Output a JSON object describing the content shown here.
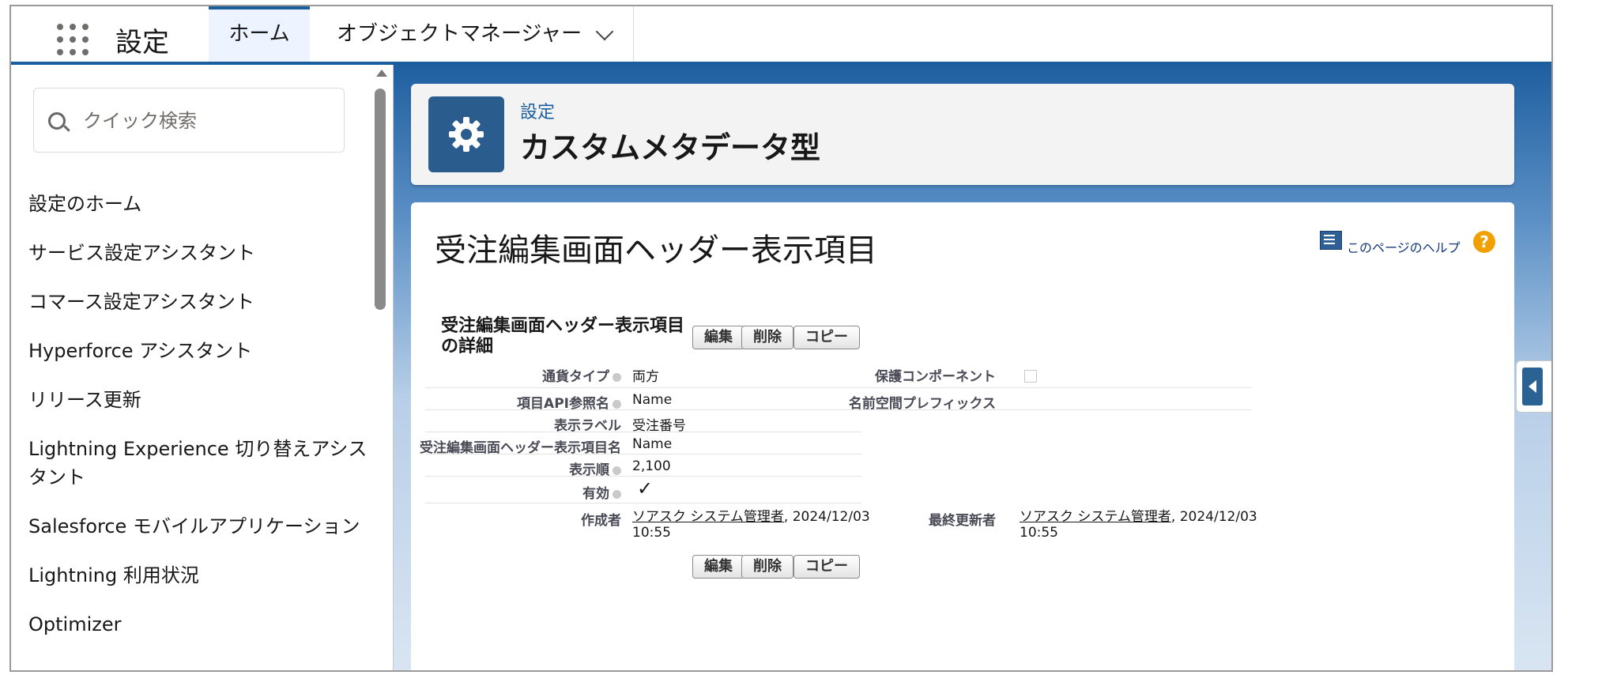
{
  "nav": {
    "app_name": "設定",
    "tabs": [
      {
        "label": "ホーム"
      },
      {
        "label": "オブジェクトマネージャー"
      }
    ]
  },
  "sidebar": {
    "search_placeholder": "クイック検索",
    "items": [
      {
        "label": "設定のホーム"
      },
      {
        "label": "サービス設定アシスタント"
      },
      {
        "label": "コマース設定アシスタント"
      },
      {
        "label": "Hyperforce アシスタント"
      },
      {
        "label": "リリース更新"
      },
      {
        "label": "Lightning Experience 切り替えアシスタント"
      },
      {
        "label": "Salesforce モバイルアプリケーション"
      },
      {
        "label": "Lightning 利用状況"
      },
      {
        "label": "Optimizer"
      }
    ]
  },
  "header": {
    "breadcrumb": "設定",
    "title": "カスタムメタデータ型"
  },
  "record": {
    "title": "受注編集画面ヘッダー表示項目",
    "help_label": "このページのヘルプ",
    "section_title": "受注編集画面ヘッダー表示項目の詳細",
    "buttons": {
      "edit": "編集",
      "delete": "削除",
      "copy": "コピー"
    },
    "fields_left": [
      {
        "label": "通貨タイプ",
        "value": "両方"
      },
      {
        "label": "項目API参照名",
        "value": "Name"
      },
      {
        "label": "表示ラベル",
        "value": "受注番号"
      },
      {
        "label": "受注編集画面ヘッダー表示項目名",
        "value": "Name"
      },
      {
        "label": "表示順",
        "value": "2,100"
      },
      {
        "label": "有効",
        "value": "✓"
      }
    ],
    "fields_right": [
      {
        "label": "保護コンポーネント",
        "value": ""
      },
      {
        "label": "名前空間プレフィックス",
        "value": ""
      }
    ],
    "created_by": {
      "label": "作成者",
      "user": "ソアスク システム管理者",
      "date": ", 2024/12/03",
      "time": "10:55"
    },
    "modified_by": {
      "label": "最終更新者",
      "user": "ソアスク システム管理者",
      "date": ", 2024/12/03",
      "time": "10:55"
    }
  }
}
